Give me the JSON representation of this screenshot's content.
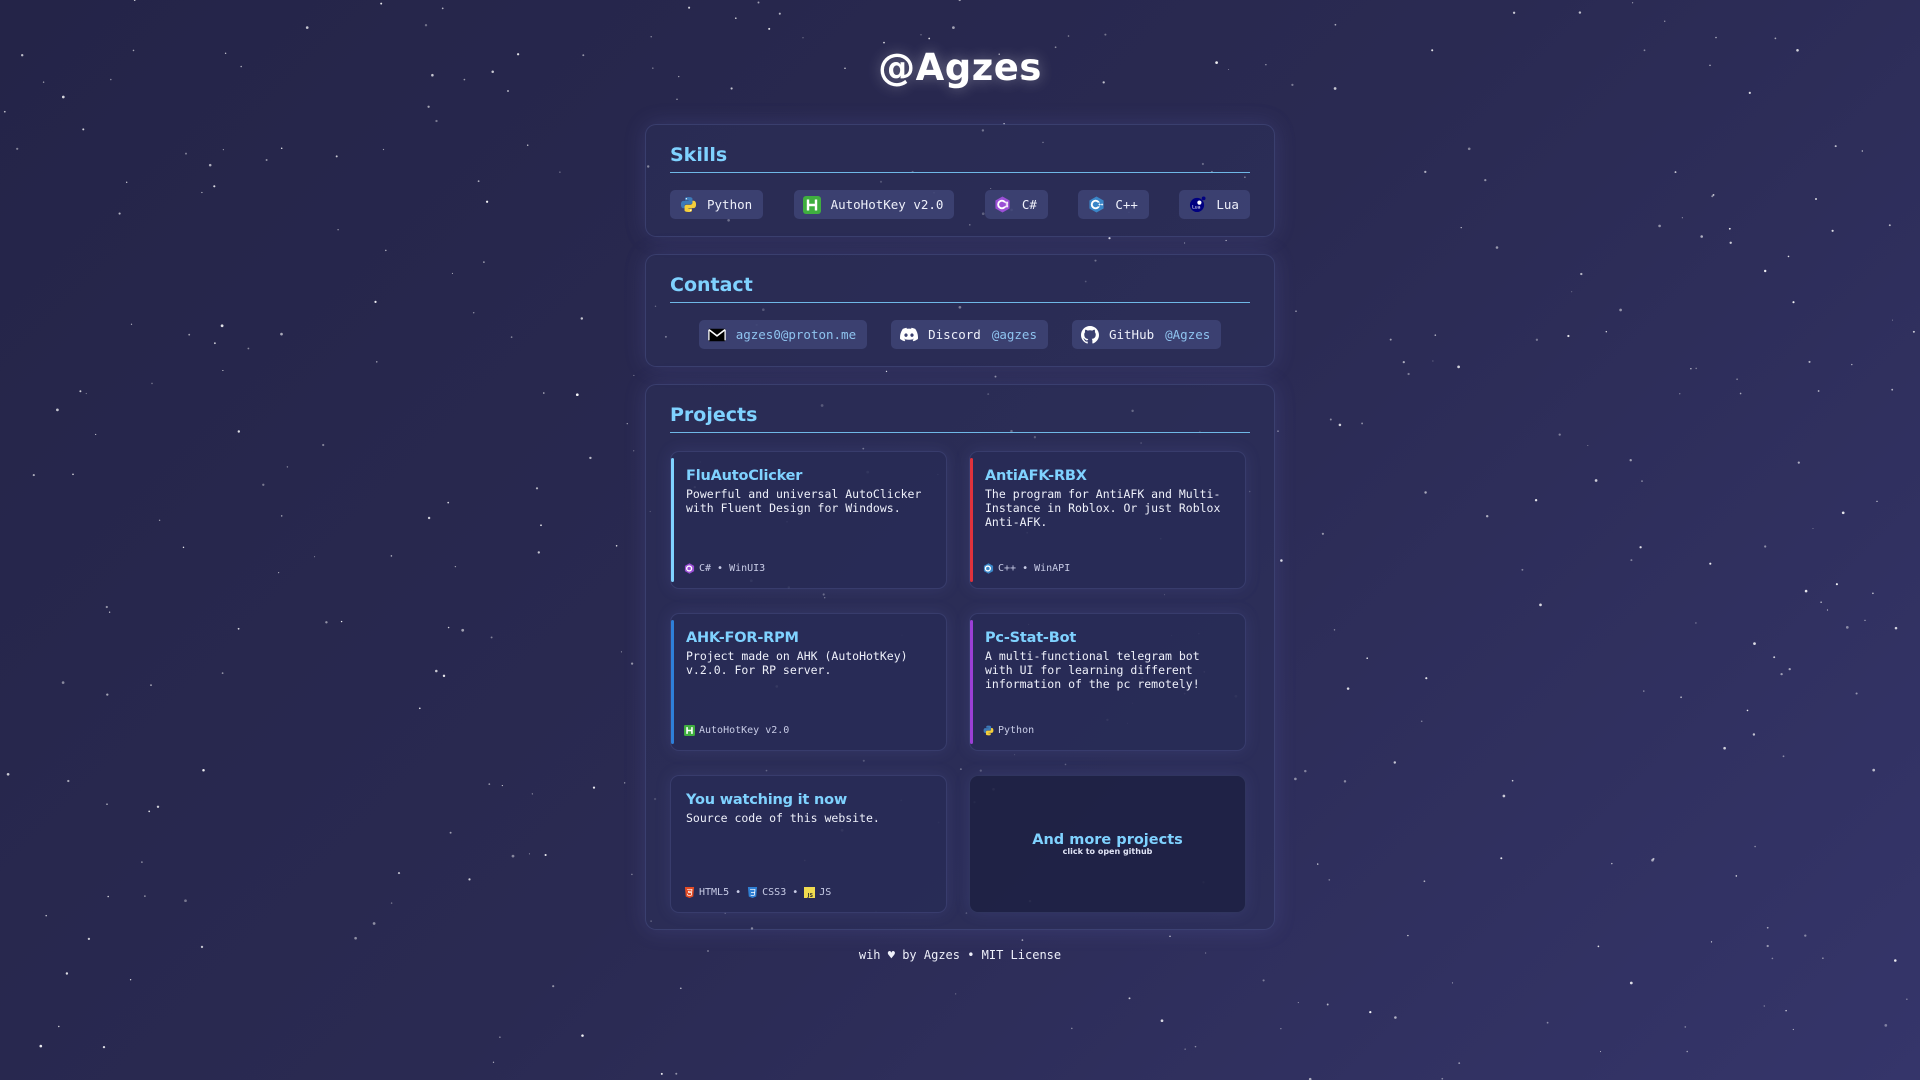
{
  "site_title": "@Agzes",
  "skills": {
    "title": "Skills",
    "items": [
      {
        "label": "Python",
        "icon": "python-icon"
      },
      {
        "label": "AutoHotKey v2.0",
        "icon": "autohotkey-icon"
      },
      {
        "label": "C#",
        "icon": "csharp-icon"
      },
      {
        "label": "C++",
        "icon": "cplusplus-icon"
      },
      {
        "label": "Lua",
        "icon": "lua-icon"
      }
    ]
  },
  "contact": {
    "title": "Contact",
    "items": [
      {
        "label": "",
        "handle": "agzes0@proton.me",
        "icon": "mail-icon"
      },
      {
        "label": "Discord",
        "handle": "@agzes",
        "icon": "discord-icon"
      },
      {
        "label": "GitHub",
        "handle": "@Agzes",
        "icon": "github-icon"
      }
    ]
  },
  "projects": {
    "title": "Projects",
    "cards": [
      {
        "title": "FluAutoClicker",
        "desc": "Powerful and universal AutoClicker\nwith Fluent Design for Windows.",
        "tags": [
          "C#",
          "WinUI3"
        ],
        "accent": "#7fd2ff"
      },
      {
        "title": "AntiAFK-RBX",
        "desc": "The program for AntiAFK and Multi-\nInstance in Roblox. Or just Roblox\nAnti-AFK.",
        "tags": [
          "C++",
          "WinAPI"
        ],
        "accent": "#e0323c"
      },
      {
        "title": "AHK-FOR-RPM",
        "desc": "Project made on AHK (AutoHotKey)\nv.2.0. For RP server.",
        "tags": [
          "AutoHotKey v2.0"
        ],
        "accent": "#2e7fd9"
      },
      {
        "title": "Pc-Stat-Bot",
        "desc": "A multi-functional telegram bot\nwith UI for learning different\ninformation of the pc remotely!",
        "tags": [
          "Python"
        ],
        "accent": "#9b3fd6"
      },
      {
        "title": "You watching it now",
        "desc": "Source code of this website.",
        "tags": [
          "HTML5",
          "CSS3",
          "JS"
        ],
        "accent": ""
      }
    ],
    "more": {
      "title": "And more projects",
      "subtitle": "click to open github"
    }
  },
  "footer": "wih ♥ by Agzes • MIT License",
  "colors": {
    "accent": "#7fd2ff",
    "background": "#2a2a52"
  }
}
